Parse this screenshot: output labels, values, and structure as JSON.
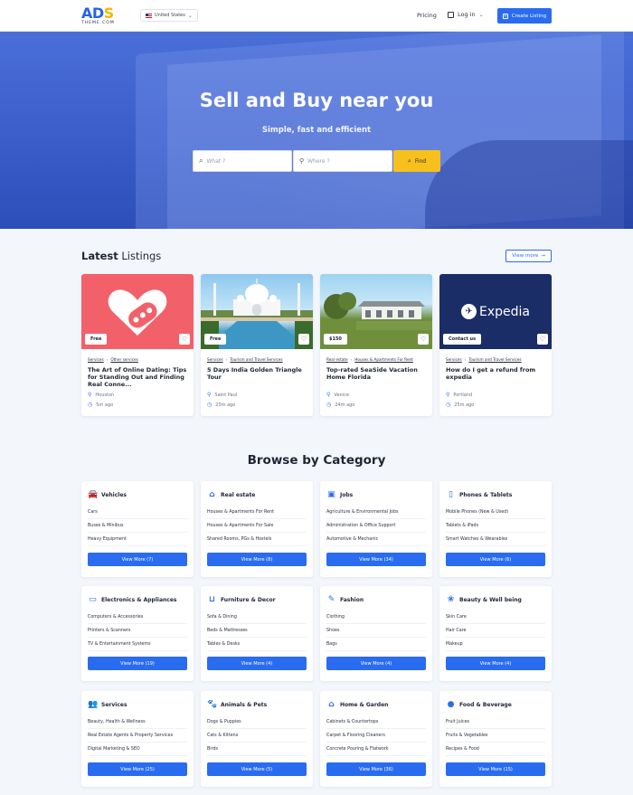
{
  "header": {
    "logo_main": "ADS",
    "logo_sub": "THEME.COM",
    "country": "United States",
    "pricing": "Pricing",
    "login": "Log in",
    "create_listing": "Create Listing"
  },
  "hero": {
    "title": "Sell and Buy near you",
    "subtitle": "Simple, fast and efficient",
    "what_placeholder": "What ?",
    "where_placeholder": "Where ?",
    "find": "Find"
  },
  "latest": {
    "title_bold": "Latest",
    "title_rest": " Listings",
    "view_more": "View more",
    "cards": [
      {
        "price": "Free",
        "cat1": "Services",
        "cat2": "Other services",
        "title": "The Art of Online Dating: Tips for Standing Out and Finding Real Conne...",
        "location": "Houston",
        "time": "5m ago"
      },
      {
        "price": "Free",
        "cat1": "Services",
        "cat2": "Tourism and Travel Services",
        "title": "5 Days India Golden Triangle Tour",
        "location": "Saint Paul",
        "time": "23m ago"
      },
      {
        "price": "$150",
        "cat1": "Real estate",
        "cat2": "Houses & Apartments For Rent",
        "title": "Top-rated SeaSide Vacation Home Florida",
        "location": "Venice",
        "time": "24m ago"
      },
      {
        "price": "Contact us",
        "cat1": "Services",
        "cat2": "Tourism and Travel Services",
        "title": "How do I get a refund from expedia",
        "location": "Portland",
        "time": "25m ago"
      }
    ],
    "expedia_logo": "Expedia"
  },
  "browse": {
    "title": "Browse by Category",
    "categories": [
      {
        "name": "Vehicles",
        "icon": "car-icon",
        "items": [
          "Cars",
          "Buses & Minibus",
          "Heavy Equipment"
        ],
        "button": "View More (7)"
      },
      {
        "name": "Real estate",
        "icon": "home-icon",
        "items": [
          "Houses & Apartments For Rent",
          "Houses & Apartments For Sale",
          "Shared Rooms, PGs & Hostels"
        ],
        "button": "View More (8)"
      },
      {
        "name": "Jobs",
        "icon": "badge-icon",
        "items": [
          "Agriculture & Environmental Jobs",
          "Administration & Office Support",
          "Automotive & Mechanic"
        ],
        "button": "View More (34)"
      },
      {
        "name": "Phones & Tablets",
        "icon": "phone-icon",
        "items": [
          "Mobile Phones (New & Used)",
          "Tablets & iPads",
          "Smart Watches & Wearables"
        ],
        "button": "View More (6)"
      },
      {
        "name": "Electronics & Appliances",
        "icon": "laptop-icon",
        "items": [
          "Computers & Accessories",
          "Printers & Scanners",
          "TV & Entertainment Systems"
        ],
        "button": "View More (19)"
      },
      {
        "name": "Furniture & Decor",
        "icon": "sofa-icon",
        "items": [
          "Sofa & Dining",
          "Beds & Mattresses",
          "Tables & Desks"
        ],
        "button": "View More (4)"
      },
      {
        "name": "Fashion",
        "icon": "brush-icon",
        "items": [
          "Clothing",
          "Shoes",
          "Bags"
        ],
        "button": "View More (4)"
      },
      {
        "name": "Beauty & Well being",
        "icon": "lotus-icon",
        "items": [
          "Skin Care",
          "Hair Care",
          "Makeup"
        ],
        "button": "View More (4)"
      },
      {
        "name": "Services",
        "icon": "people-icon",
        "items": [
          "Beauty, Health & Wellness",
          "Real Estate Agents & Property Services",
          "Digital Marketing & SEO"
        ],
        "button": "View More (25)"
      },
      {
        "name": "Animals & Pets",
        "icon": "paw-icon",
        "items": [
          "Dogs & Puppies",
          "Cats & Kittens",
          "Birds"
        ],
        "button": "View More (5)"
      },
      {
        "name": "Home & Garden",
        "icon": "house-garden-icon",
        "items": [
          "Cabinets & Countertops",
          "Carpet & Flooring Cleaners",
          "Concrete Pouring & Flatwork"
        ],
        "button": "View More (36)"
      },
      {
        "name": "Food & Beverage",
        "icon": "food-icon",
        "items": [
          "Fruit Juices",
          "Fruits & Vegetables",
          "Recipes & Food"
        ],
        "button": "View More (15)"
      }
    ]
  },
  "colors": {
    "primary": "#2a6cf0",
    "accent": "#f7c01d",
    "dating": "#f2616a",
    "expedia": "#1b2d66"
  }
}
